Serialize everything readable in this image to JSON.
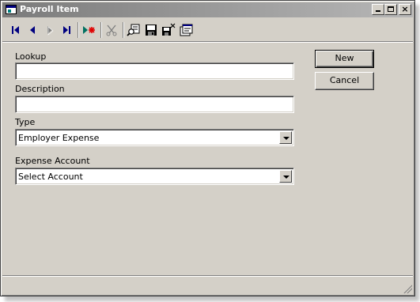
{
  "window": {
    "title": "Payroll Item",
    "controls": {
      "minimize": "",
      "maximize": "",
      "close": "×"
    }
  },
  "toolbar": {
    "icons": [
      "first-record-icon",
      "previous-record-icon",
      "next-record-icon",
      "last-record-icon",
      "new-record-icon",
      "delete-icon",
      "find-icon",
      "save-icon",
      "save-close-icon",
      "properties-icon"
    ]
  },
  "form": {
    "lookup": {
      "label": "Lookup",
      "value": ""
    },
    "description": {
      "label": "Description",
      "value": ""
    },
    "type": {
      "label": "Type",
      "value": "Employer Expense"
    },
    "expense_account": {
      "label": "Expense Account",
      "value": "Select Account"
    }
  },
  "buttons": {
    "new": "New",
    "cancel": "Cancel"
  },
  "colors": {
    "face": "#d4d0c8",
    "title_gradient_start": "#7b7b7b",
    "title_gradient_end": "#b7b7b7",
    "nav_blue": "#000080",
    "accent_red": "#e00000"
  }
}
